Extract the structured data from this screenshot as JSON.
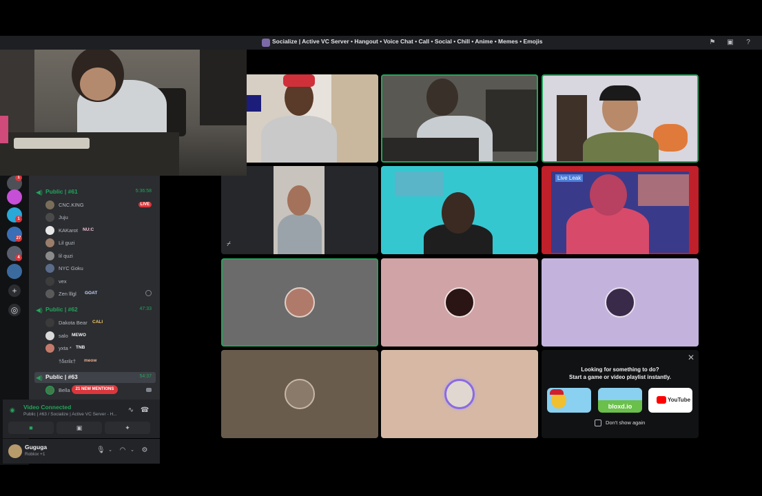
{
  "window": {
    "title": "Socialize | Active VC Server • Hangout • Voice Chat • Call • Social • Chill • Anime • Memes • Emojis"
  },
  "rail": {
    "badges": [
      "1",
      "1",
      "27",
      "4"
    ]
  },
  "channels": [
    {
      "name": "Public | #61",
      "time": "5:36:58",
      "members": [
        {
          "name": "CNC.KING",
          "live": "LIVE"
        },
        {
          "name": "Juju"
        },
        {
          "name": "KAKarot",
          "tag": "NU:C"
        },
        {
          "name": "Lil guzi"
        },
        {
          "name": "lil quzi"
        },
        {
          "name": "NYC Goku"
        },
        {
          "name": "vex"
        },
        {
          "name": "Zen lllgl",
          "tag": "GOAT"
        }
      ]
    },
    {
      "name": "Public | #62",
      "time": "47:33",
      "members": [
        {
          "name": "Dakota Bear",
          "tag": "CALI"
        },
        {
          "name": "salo",
          "tag": "MEWO"
        },
        {
          "name": "yxta *",
          "tag": "TNB"
        },
        {
          "name": "†δεrilε†",
          "tag": "meow"
        }
      ]
    },
    {
      "name": "Public | #63",
      "time": "54:37",
      "members": [
        {
          "name": "Bella"
        }
      ]
    }
  ],
  "mentions_pill": "21 NEW MENTIONS",
  "voice": {
    "status": "Video Connected",
    "location": "Public | #63 / Socialize | Active VC Server - H..."
  },
  "user": {
    "name": "Guguga",
    "status": "Roblox +1"
  },
  "tiles": {
    "liveleak_label": "Live Leak",
    "avatar_colors": [
      "#6b6b6b",
      "#d0a3a6",
      "#c3b3dc",
      "#6a5c4c",
      "#d6b8a4"
    ]
  },
  "activity": {
    "heading_line1": "Looking for something to do?",
    "heading_line2": "Start a game or video playlist instantly.",
    "apps": [
      "",
      "bloxd.io",
      "YouTube"
    ],
    "dont_show": "Don't show again"
  },
  "colors": {
    "accent_green": "#23a55a",
    "live_red": "#da373c",
    "sidebar": "#2b2d31",
    "panel": "#232428"
  }
}
